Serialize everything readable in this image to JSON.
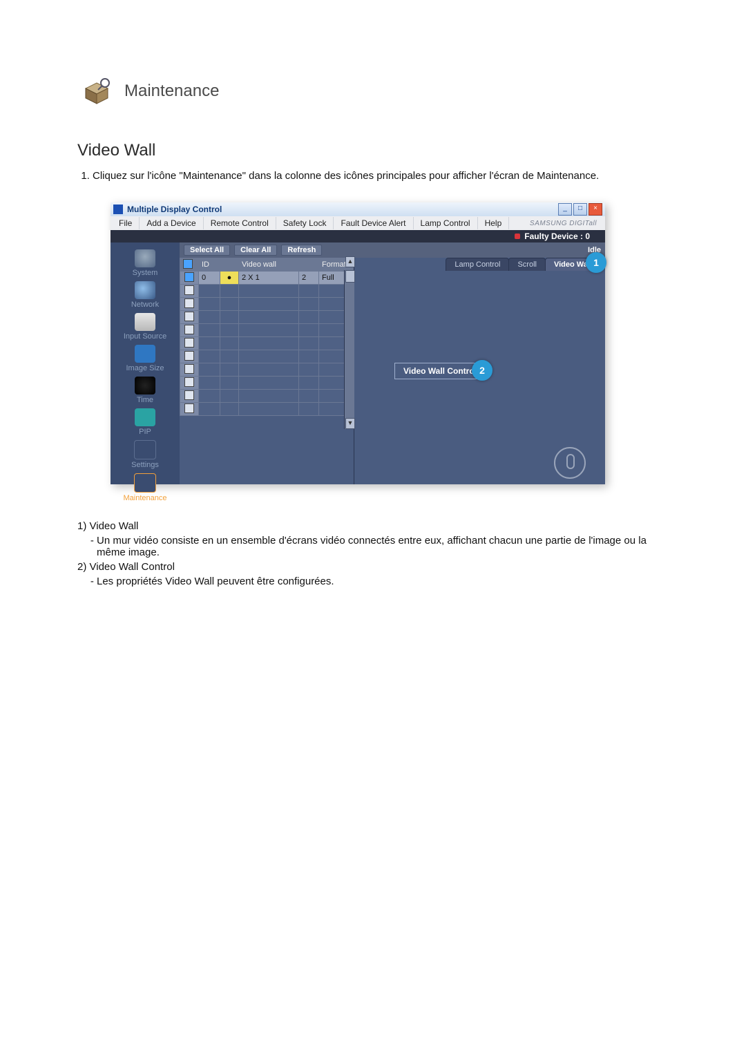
{
  "page": {
    "heading": "Maintenance",
    "section": "Video Wall",
    "instruction_1": "Cliquez sur l'icône \"Maintenance\" dans la colonne des icônes principales pour afficher l'écran de Maintenance."
  },
  "window": {
    "title": "Multiple Display Control",
    "btn_min": "_",
    "btn_max": "□",
    "btn_close": "×",
    "menu": [
      "File",
      "Add a Device",
      "Remote Control",
      "Safety Lock",
      "Fault Device Alert",
      "Lamp Control",
      "Help"
    ],
    "brand": "SAMSUNG DIGITall",
    "faulty": "Faulty Device : 0",
    "toolbar": {
      "select_all": "Select All",
      "clear_all": "Clear All",
      "refresh": "Refresh",
      "idle": "Idle"
    },
    "sidebar": [
      "System",
      "Network",
      "Input Source",
      "Image Size",
      "Time",
      "PIP",
      "Settings",
      "Maintenance"
    ],
    "table": {
      "headers": {
        "chk": "",
        "id": "ID",
        "st": "",
        "vw": "Video wall",
        "n": "",
        "fmt": "Format"
      },
      "row": {
        "id": "0",
        "vw": "2 X 1",
        "n": "2",
        "fmt": "Full"
      }
    },
    "subtabs": {
      "lamp": "Lamp Control",
      "scroll": "Scroll",
      "video": "Video Wall"
    },
    "vwc_button": "Video Wall Control",
    "callouts": {
      "n1": "1",
      "n2": "2"
    }
  },
  "legend": {
    "i1_title": "1)  Video Wall",
    "i1_body": "Un mur vidéo consiste en un ensemble d'écrans vidéo connectés entre eux, affichant chacun une partie de l'image ou la même image.",
    "i2_title": "2)  Video Wall Control",
    "i2_body": "Les propriétés Video Wall peuvent être configurées."
  }
}
